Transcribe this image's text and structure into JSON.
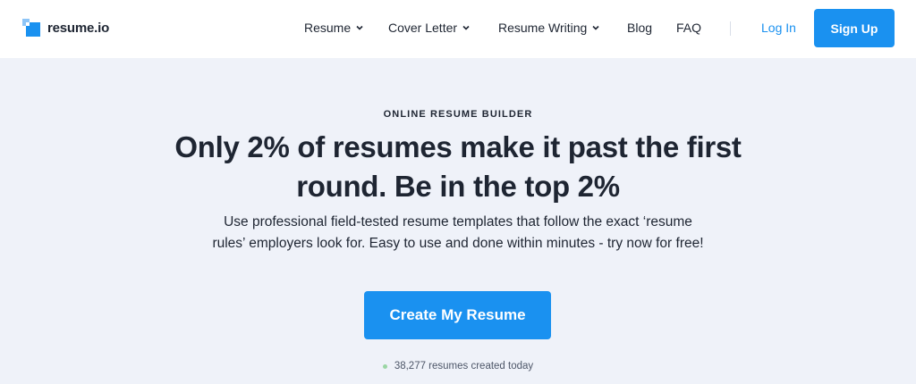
{
  "brand": {
    "name": "resume.io",
    "accent": "#1a91f0"
  },
  "nav": {
    "items": [
      {
        "label": "Resume",
        "has_dropdown": true
      },
      {
        "label": "Cover Letter",
        "has_dropdown": true
      },
      {
        "label": "Resume Writing",
        "has_dropdown": true
      },
      {
        "label": "Blog",
        "has_dropdown": false
      },
      {
        "label": "FAQ",
        "has_dropdown": false
      }
    ],
    "login_label": "Log In",
    "signup_label": "Sign Up"
  },
  "hero": {
    "eyebrow": "ONLINE RESUME BUILDER",
    "headline": "Only 2% of resumes make it past the first round. Be in the top 2%",
    "subtext": "Use professional field-tested resume templates that follow the exact ‘resume rules’ employers look for. Easy to use and done within minutes - try now for free!",
    "cta_label": "Create My Resume",
    "counter_text": "38,277 resumes created today",
    "counter_dot_color": "#9ad6a4"
  }
}
